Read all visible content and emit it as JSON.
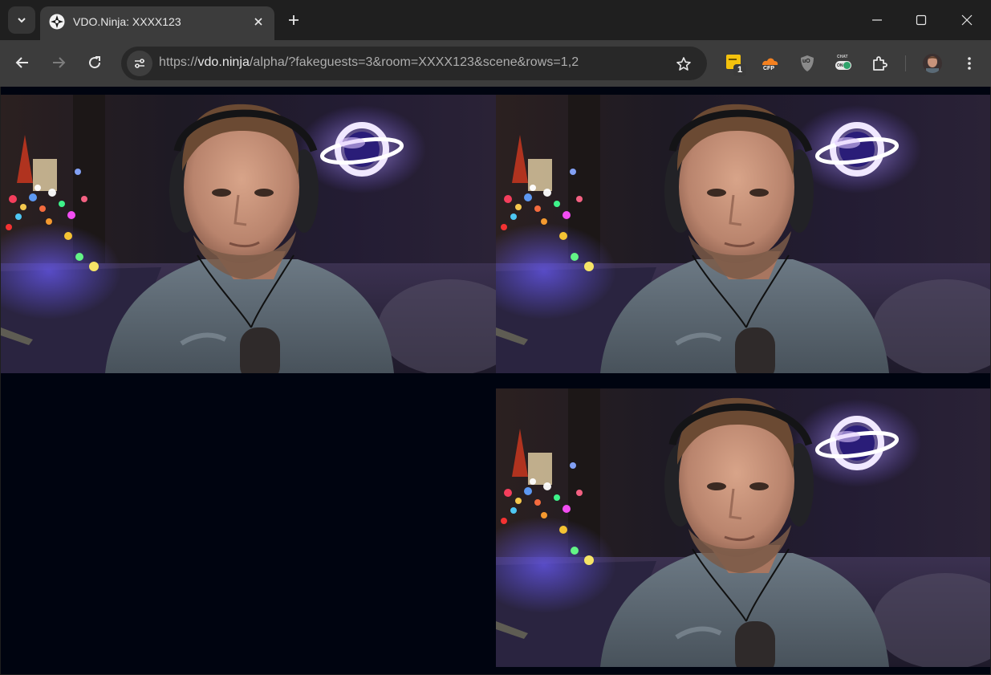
{
  "browser": {
    "tab": {
      "title": "VDO.Ninja: XXXX123",
      "favicon": "vdo-ninja-favicon-icon"
    },
    "address": {
      "scheme": "https://",
      "host": "vdo.ninja",
      "path": "/alpha/?fakeguests=3&room=XXXX123&scene&rows=1,2"
    },
    "extensions": [
      {
        "name": "sticky-note-extension-icon",
        "badge": "1"
      },
      {
        "name": "cfp-extension-icon",
        "label": "CFP"
      },
      {
        "name": "ublock-origin-icon",
        "label": "uO"
      },
      {
        "name": "chat-toggle-extension-icon",
        "label": "CHAT",
        "state": "ON"
      },
      {
        "name": "extensions-puzzle-icon"
      }
    ]
  },
  "scene": {
    "background_color": "#000410",
    "tiles": [
      {
        "name": "guest-video-1",
        "row": 1,
        "column": 1
      },
      {
        "name": "guest-video-2",
        "row": 1,
        "column": 2
      },
      {
        "name": "empty-slot",
        "row": 2,
        "column": 1
      },
      {
        "name": "guest-video-3",
        "row": 2,
        "column": 2
      }
    ]
  },
  "colors": {
    "tab_strip": "#1f1f1f",
    "toolbar": "#3c3c3c",
    "omnibox": "#282828",
    "text": "#e8e8e8"
  }
}
